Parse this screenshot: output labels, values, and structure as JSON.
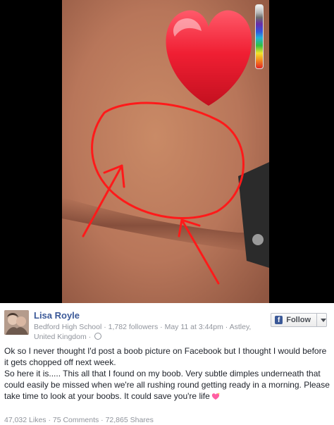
{
  "post": {
    "author": "Lisa Royle",
    "meta": "Bedford High School · 1,782 followers · May 11 at 3:44pm · Astley, United Kingdom ·",
    "follow_label": "Follow",
    "paragraph_1": "Ok so I never thought I'd post a boob picture on Facebook but I thought I would before it gets chopped off next week.",
    "paragraph_2": "So here it is..... This all that I found on my boob. Very subtle dimples underneath that could easily be missed when we're all rushing round getting ready in a morning. Please take time to look at your boobs. It could save you're life",
    "stats": "47,032 Likes · 75 Comments · 72,865 Shares"
  },
  "icons": {
    "heart_sticker": "heart-icon",
    "emoji": "sparkling-heart-icon",
    "privacy": "globe-icon",
    "follow_icon": "facebook-icon",
    "dropdown": "chevron-down-icon"
  },
  "colors": {
    "link": "#3b5998",
    "muted": "#90949c",
    "annotation": "#ff1a1a",
    "heart": "#e01a2a"
  }
}
